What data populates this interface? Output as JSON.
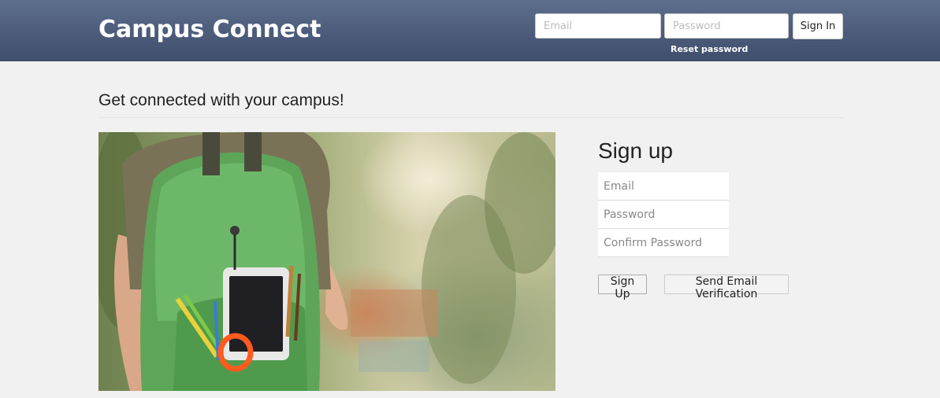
{
  "header": {
    "brand": "Campus Connect",
    "email_placeholder": "Email",
    "password_placeholder": "Password",
    "signin_label": "Sign In",
    "reset_link": "Reset password"
  },
  "main": {
    "tagline": "Get connected with your campus!",
    "hero_image": "student-with-green-backpack"
  },
  "signup": {
    "title": "Sign up",
    "email_placeholder": "Email",
    "password_placeholder": "Password",
    "confirm_placeholder": "Confirm Password",
    "signup_button": "Sign Up",
    "verify_button": "Send Email Verification"
  },
  "colors": {
    "header_top": "#5e6f8e",
    "header_bottom": "#3f4e6b",
    "page_bg": "#f1f1f1"
  }
}
